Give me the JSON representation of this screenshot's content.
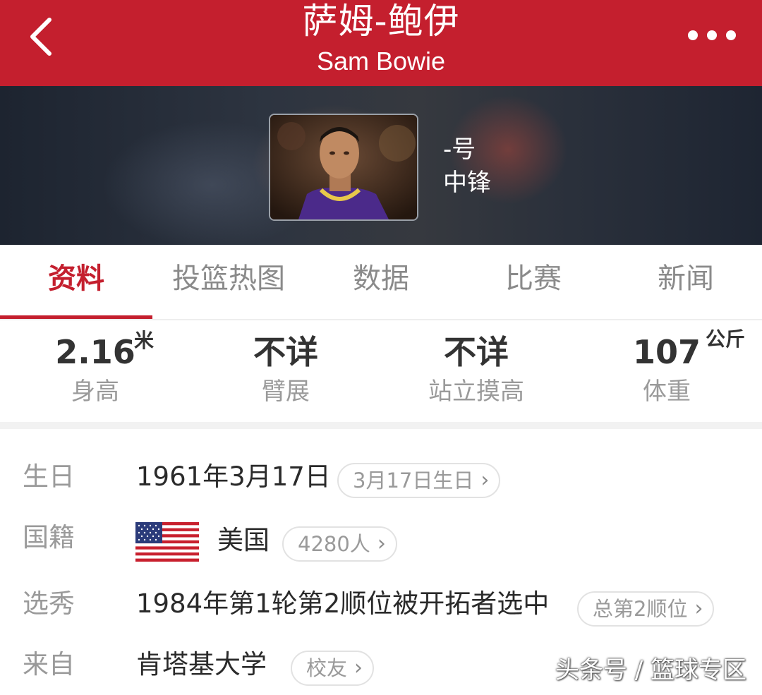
{
  "header": {
    "title_cn": "萨姆-鲍伊",
    "title_en": "Sam Bowie",
    "back_icon": "chevron-left-icon",
    "more_icon": "more-dots-icon"
  },
  "banner": {
    "jersey_number": "-号",
    "position": "中锋"
  },
  "tabs": [
    {
      "label": "资料",
      "active": true
    },
    {
      "label": "投篮热图",
      "active": false
    },
    {
      "label": "数据",
      "active": false
    },
    {
      "label": "比赛",
      "active": false
    },
    {
      "label": "新闻",
      "active": false
    }
  ],
  "stats": [
    {
      "value": "2.16",
      "unit": "米",
      "label": "身高"
    },
    {
      "value": "不详",
      "unit": "",
      "label": "臂展"
    },
    {
      "value": "不详",
      "unit": "",
      "label": "站立摸高"
    },
    {
      "value": "107",
      "unit": "公斤",
      "label": "体重"
    }
  ],
  "info": {
    "birthday": {
      "label": "生日",
      "value": "1961年3月17日",
      "pill": "3月17日生日"
    },
    "nationality": {
      "label": "国籍",
      "value": "美国",
      "pill": "4280人",
      "flag_icon": "us-flag-icon"
    },
    "draft": {
      "label": "选秀",
      "value": "1984年第1轮第2顺位被开拓者选中",
      "pill": "总第2顺位"
    },
    "college": {
      "label": "来自",
      "value": "肯塔基大学",
      "pill": "校友"
    }
  },
  "watermark": "头条号 / 篮球专区",
  "colors": {
    "brand_red": "#c41f2e",
    "label_gray": "#9a9a9a"
  }
}
